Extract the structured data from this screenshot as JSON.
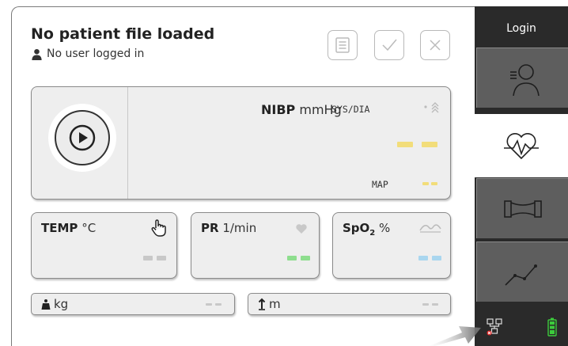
{
  "header": {
    "title": "No patient file loaded",
    "user_status": "No user logged in"
  },
  "nibp": {
    "name": "NIBP",
    "unit": "mmHg",
    "mode": "SYS/DIA",
    "map_label": "MAP",
    "color": "#f2dd7a"
  },
  "temp": {
    "name": "TEMP",
    "unit": "°C",
    "color": "#c8c8c8"
  },
  "pr": {
    "name": "PR",
    "unit": "1/min",
    "color": "#8ede8e"
  },
  "spo2": {
    "name": "SpO",
    "sub": "2",
    "unit": "%",
    "color": "#a9d6ef"
  },
  "weight": {
    "unit": "kg"
  },
  "height": {
    "unit": "m"
  },
  "nav": {
    "login_label": "Login",
    "tabs": [
      "patient-list",
      "vitals",
      "body-measurements",
      "trends"
    ],
    "active_tab": "vitals"
  },
  "colors": {
    "battery": "#3ccb3c",
    "error": "#e02020",
    "nav_bg": "#2a2a2a"
  }
}
